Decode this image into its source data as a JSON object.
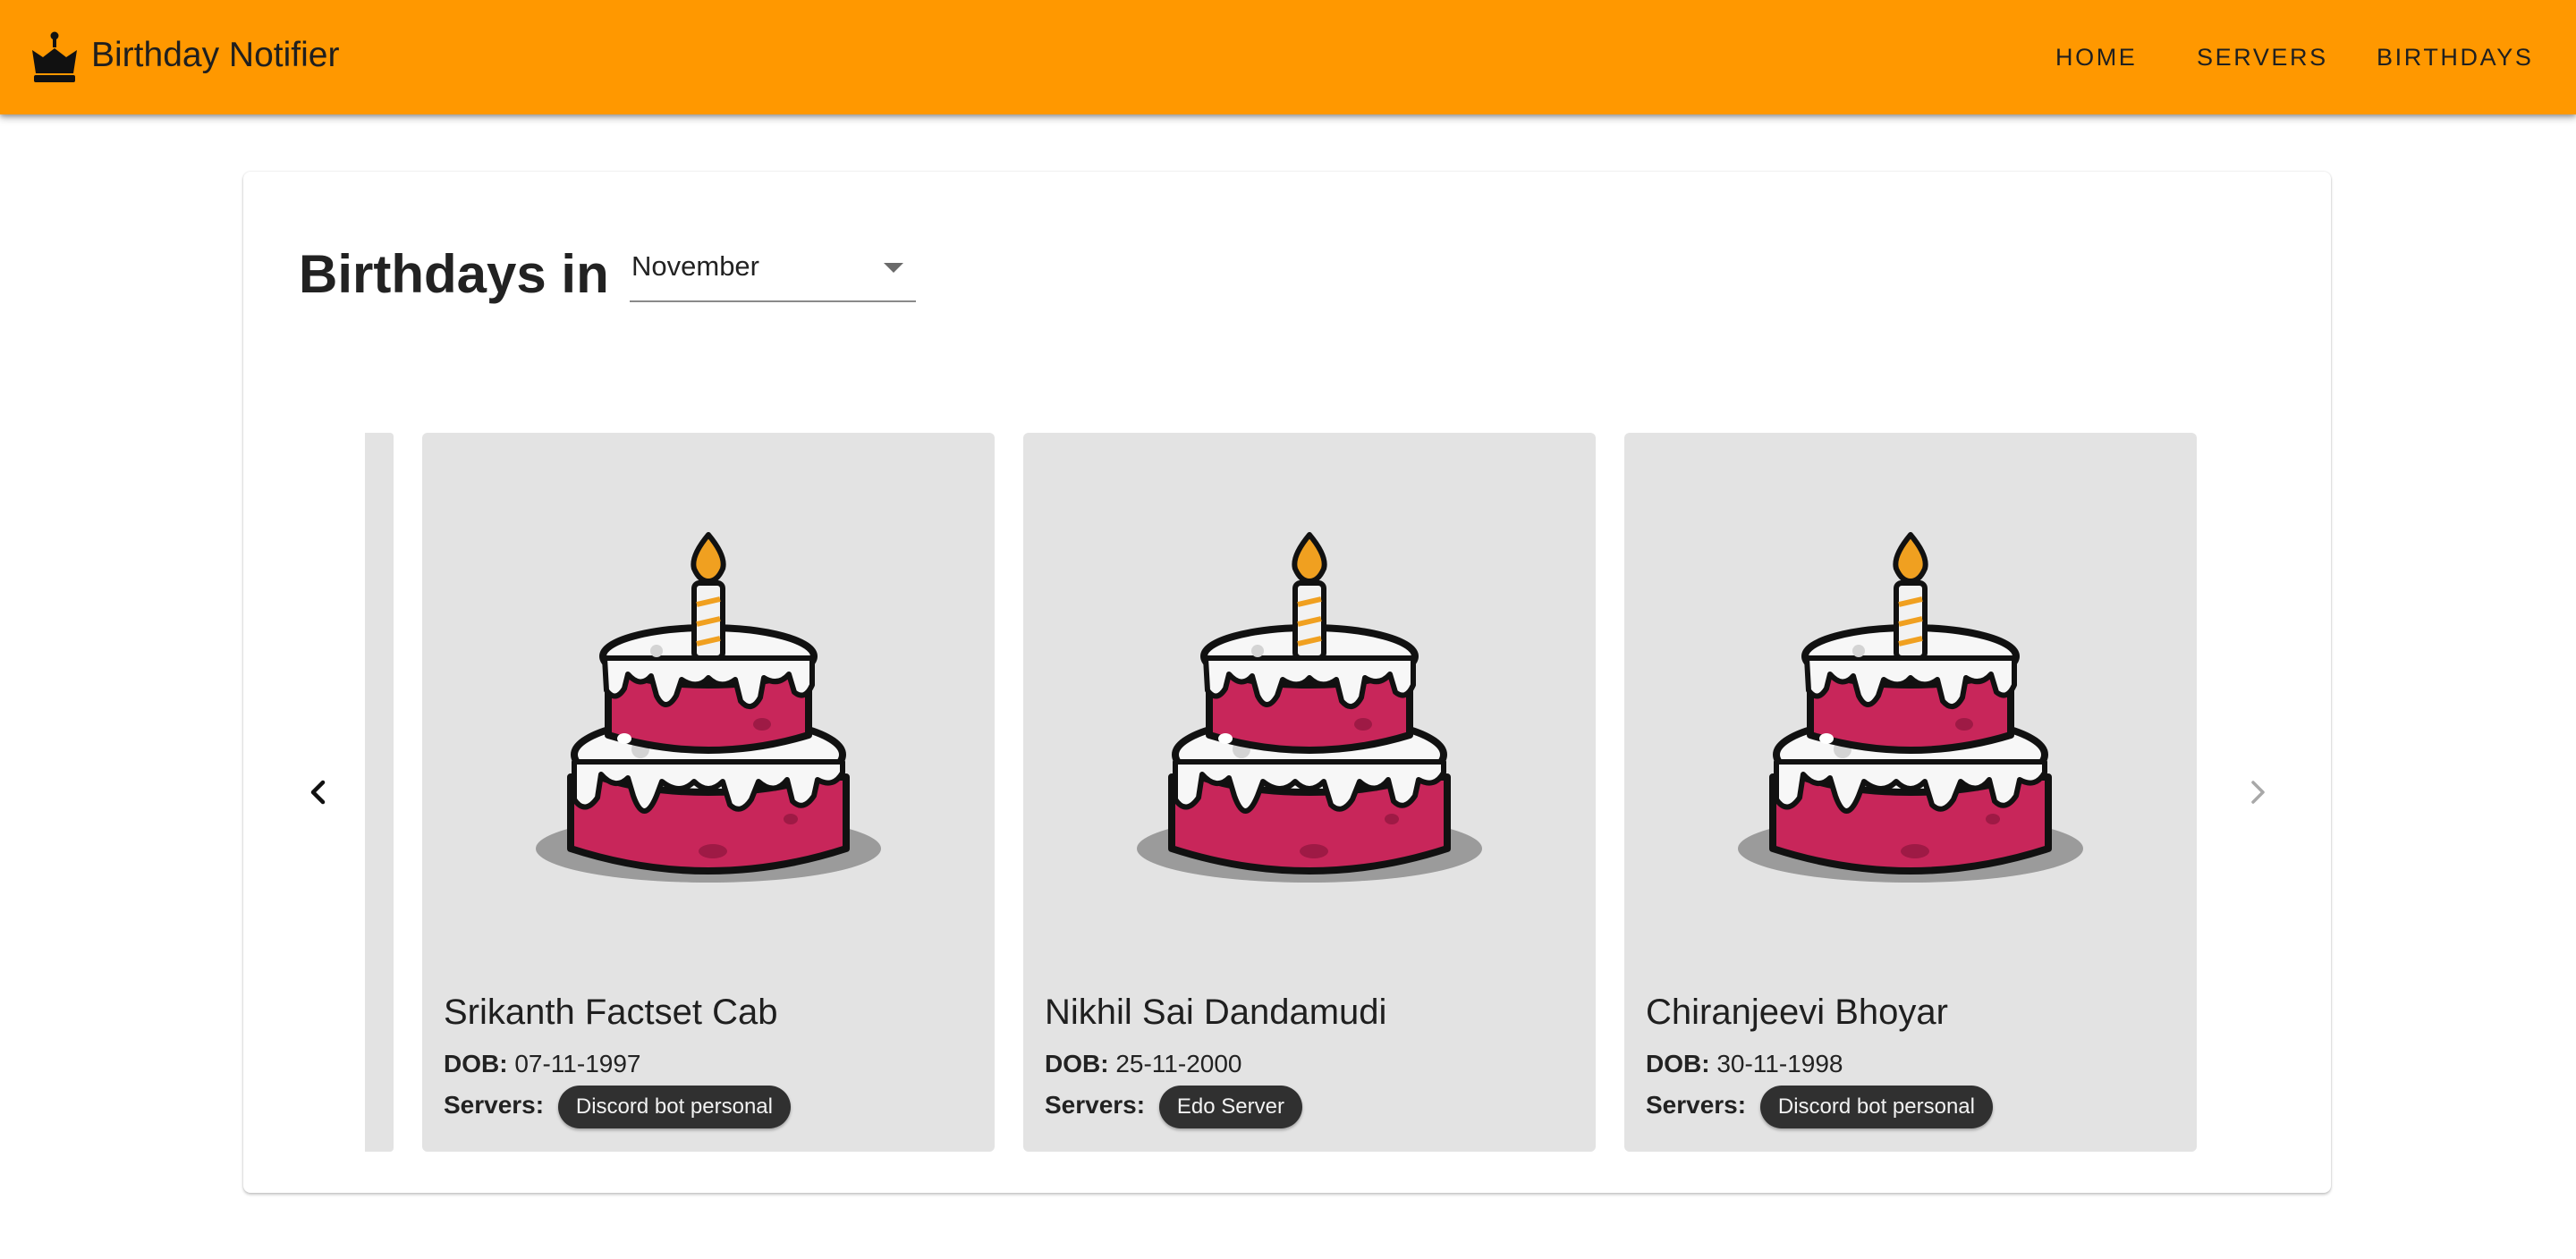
{
  "app": {
    "title": "Birthday Notifier",
    "icon": "crown-cake-icon"
  },
  "nav": {
    "home": "HOME",
    "servers": "SERVERS",
    "birthdays": "BIRTHDAYS"
  },
  "page": {
    "heading": "Birthdays in",
    "month": "November"
  },
  "labels": {
    "dob": "DOB:",
    "servers": "Servers:"
  },
  "cards": [
    {
      "name": "Srikanth Factset Cab",
      "dob": "07-11-1997",
      "server": "Discord bot personal",
      "image": "birthday-cake-icon"
    },
    {
      "name": "Nikhil Sai Dandamudi",
      "dob": "25-11-2000",
      "server": "Edo Server",
      "image": "birthday-cake-icon"
    },
    {
      "name": "Chiranjeevi Bhoyar",
      "dob": "30-11-1998",
      "server": "Discord bot personal",
      "image": "birthday-cake-icon"
    }
  ],
  "colors": {
    "appbar": "#ff9800",
    "card": "#e3e3e3",
    "chip": "#303030",
    "cake_frosting": "#c8265a",
    "candle_flame": "#f0a020"
  }
}
